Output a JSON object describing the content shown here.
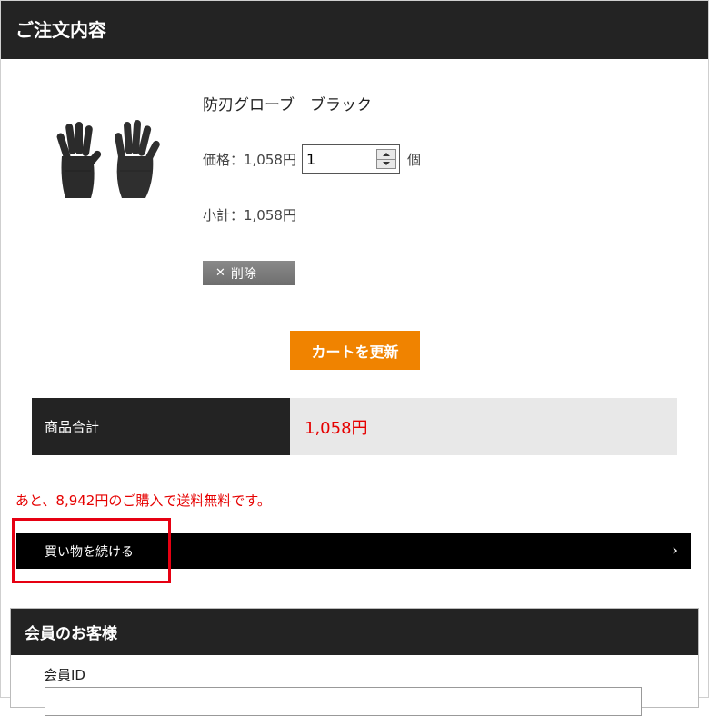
{
  "order": {
    "header_title": "ご注文内容",
    "item": {
      "name": "防刃グローブ　ブラック",
      "price_label": "価格：1,058円",
      "quantity": "1",
      "unit_label": "個",
      "subtotal_label": "小計：1,058円",
      "delete_label": "削除"
    },
    "update_cart_label": "カートを更新",
    "total_label": "商品合計",
    "total_value": "1,058円",
    "shipping_notice": "あと、8,942円のご購入で送料無料です。",
    "continue_shopping_label": "買い物を続ける"
  },
  "member": {
    "header_title": "会員のお客様",
    "id_label": "会員ID"
  },
  "colors": {
    "header_bg": "#232323",
    "accent_orange": "#f08300",
    "alert_red": "#e60000",
    "highlight_red": "#e60012"
  }
}
